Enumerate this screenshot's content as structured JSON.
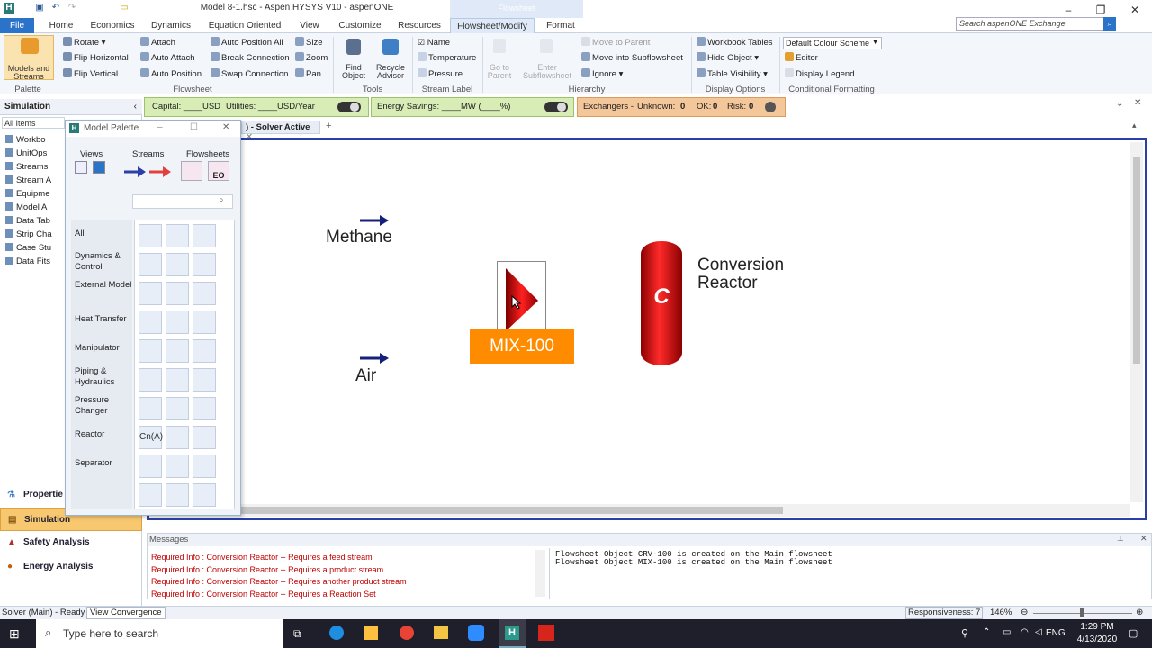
{
  "window": {
    "title": "Model 8-1.hsc - Aspen HYSYS V10 - aspenONE",
    "context_tab": "Flowsheet"
  },
  "ribbon_tabs": [
    "File",
    "Home",
    "Economics",
    "Dynamics",
    "Equation Oriented",
    "View",
    "Customize",
    "Resources",
    "Flowsheet/Modify",
    "Format"
  ],
  "search": {
    "placeholder": "Search aspenONE Exchange"
  },
  "ribbon": {
    "palette": {
      "big_label_1": "Models and",
      "big_label_2": "Streams",
      "group": "Palette"
    },
    "flowsheet": {
      "rotate": "Rotate",
      "flip_h": "Flip Horizontal",
      "flip_v": "Flip Vertical",
      "attach": "Attach",
      "auto_attach": "Auto Attach",
      "auto_position": "Auto Position",
      "auto_position_all": "Auto Position All",
      "break_connection": "Break Connection",
      "swap_connection": "Swap Connection",
      "size": "Size",
      "zoom": "Zoom",
      "pan": "Pan",
      "group": "Flowsheet"
    },
    "tools": {
      "find_1": "Find",
      "find_2": "Object",
      "recycle_1": "Recycle",
      "recycle_2": "Advisor",
      "group": "Tools"
    },
    "stream_label": {
      "name": "Name",
      "temperature": "Temperature",
      "pressure": "Pressure",
      "group": "Stream Label"
    },
    "hierarchy": {
      "goto_1": "Go to",
      "goto_2": "Parent",
      "enter_1": "Enter",
      "enter_2": "Subflowsheet",
      "move_parent": "Move to Parent",
      "move_into": "Move into Subflowsheet",
      "ignore": "Ignore",
      "group": "Hierarchy"
    },
    "display": {
      "workbook_tables": "Workbook Tables",
      "hide_object": "Hide Object",
      "table_visibility": "Table Visibility",
      "group": "Display Options"
    },
    "conditional": {
      "scheme": "Default Colour Scheme",
      "editor": "Editor",
      "display_legend": "Display Legend",
      "group": "Conditional Formatting"
    }
  },
  "econ_bar": {
    "capital": "Capital: ____USD",
    "utilities": "Utilities: ____USD/Year",
    "energy": "Energy Savings: ____MW   (____%)",
    "exchangers": "Exchangers -",
    "unknown_label": "Unknown:",
    "unknown": "0",
    "ok_label": "OK:",
    "ok": "0",
    "risk_label": "Risk:",
    "risk": "0"
  },
  "nav": {
    "header": "Simulation",
    "filter": "All Items",
    "tree": [
      "Workbo",
      "UnitOps",
      "Streams",
      "Stream A",
      "Equipme",
      "Model A",
      "Data Tab",
      "Strip Cha",
      "Case Stu",
      "Data Fits"
    ],
    "buttons": [
      "Propertie",
      "Simulation",
      "Safety Analysis",
      "Energy Analysis"
    ]
  },
  "palette": {
    "title": "Model Palette",
    "views": "Views",
    "streams": "Streams",
    "flowsheets": "Flowsheets",
    "eo": "EO",
    "categories": [
      "All",
      "Dynamics & Control",
      "External Model",
      "Heat Transfer",
      "Manipulator",
      "Piping & Hydraulics",
      "Pressure Changer",
      "Reactor",
      "Separator"
    ],
    "cnA": "Cn(A)"
  },
  "tab": {
    "label": ") - Solver Active"
  },
  "pfd": {
    "methane": "Methane",
    "air": "Air",
    "mixer": "MIX-100",
    "reactor_letter": "C",
    "reactor_label_1": "Conversion",
    "reactor_label_2": "Reactor"
  },
  "messages": {
    "header": "Messages",
    "left": [
      "Required Info : Conversion Reactor -- Requires a feed stream",
      "Required Info : Conversion Reactor -- Requires a product stream",
      "Required Info : Conversion Reactor -- Requires another product stream",
      "Required Info : Conversion Reactor -- Requires a Reaction Set"
    ],
    "right": [
      "Flowsheet Object CRV-100 is created on the Main flowsheet",
      "Flowsheet Object MIX-100 is created on the Main flowsheet"
    ]
  },
  "status": {
    "solver": "Solver (Main) - Ready",
    "convergence": "View Convergence",
    "responsiveness": "Responsiveness: 7",
    "zoom": "146%"
  },
  "taskbar": {
    "search": "Type here to search",
    "lang": "ENG",
    "time": "1:29 PM",
    "date": "4/13/2020"
  }
}
